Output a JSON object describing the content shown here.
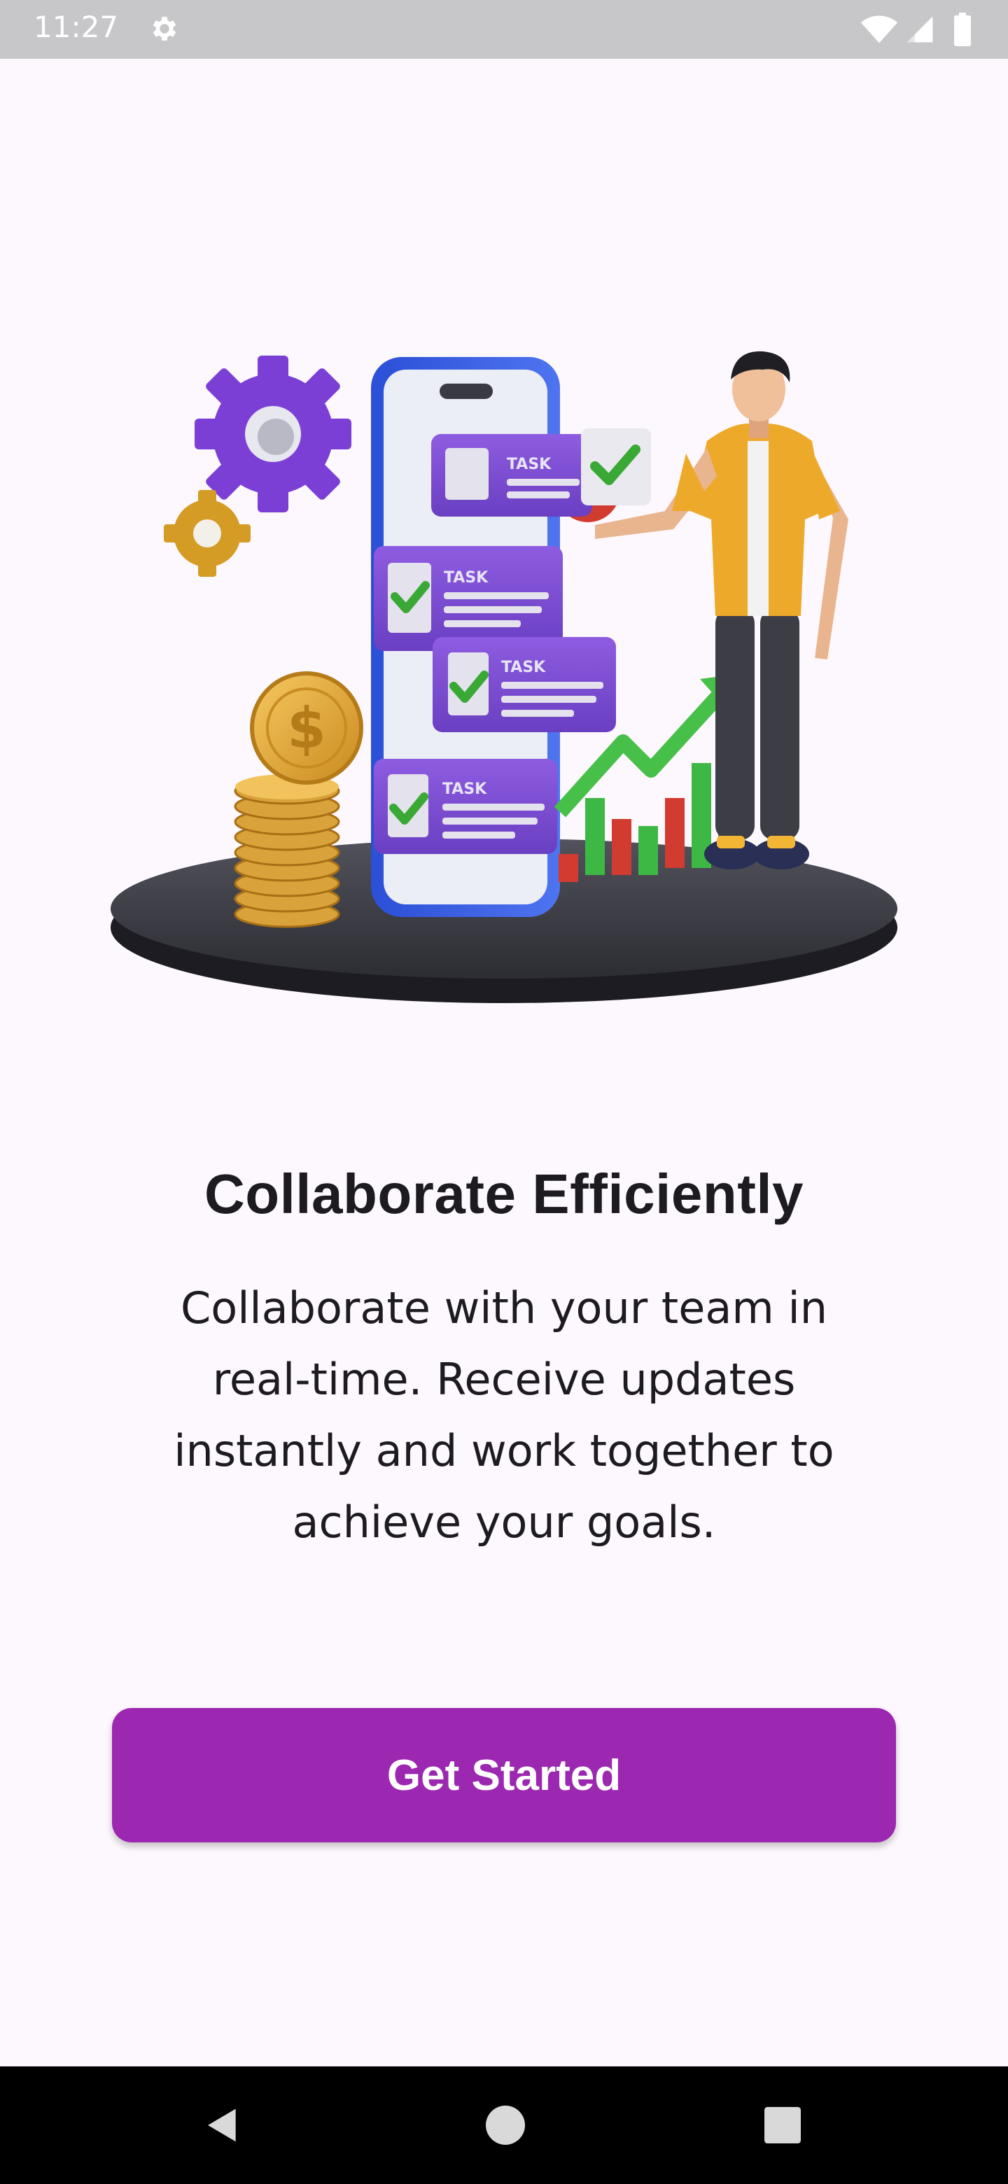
{
  "status_bar": {
    "time": "11:27",
    "icons": [
      "gear-icon",
      "wifi-icon",
      "cellular-signal-icon",
      "battery-icon"
    ]
  },
  "illustration": {
    "card_labels": [
      "TASK",
      "TASK",
      "TASK",
      "TASK"
    ]
  },
  "onboarding": {
    "title": "Collaborate Efficiently",
    "description_lines": [
      "Collaborate with your team in",
      "real-time. Receive updates",
      "instantly and work together to",
      "achieve your goals."
    ],
    "cta_label": "Get Started"
  },
  "nav_bar": {
    "icons": [
      "back-icon",
      "home-icon",
      "recents-icon"
    ]
  },
  "colors": {
    "primary": "#9c27b0",
    "background": "#fdf8fd",
    "text": "#1d1b20",
    "status_bar": "#c7c7c9"
  }
}
